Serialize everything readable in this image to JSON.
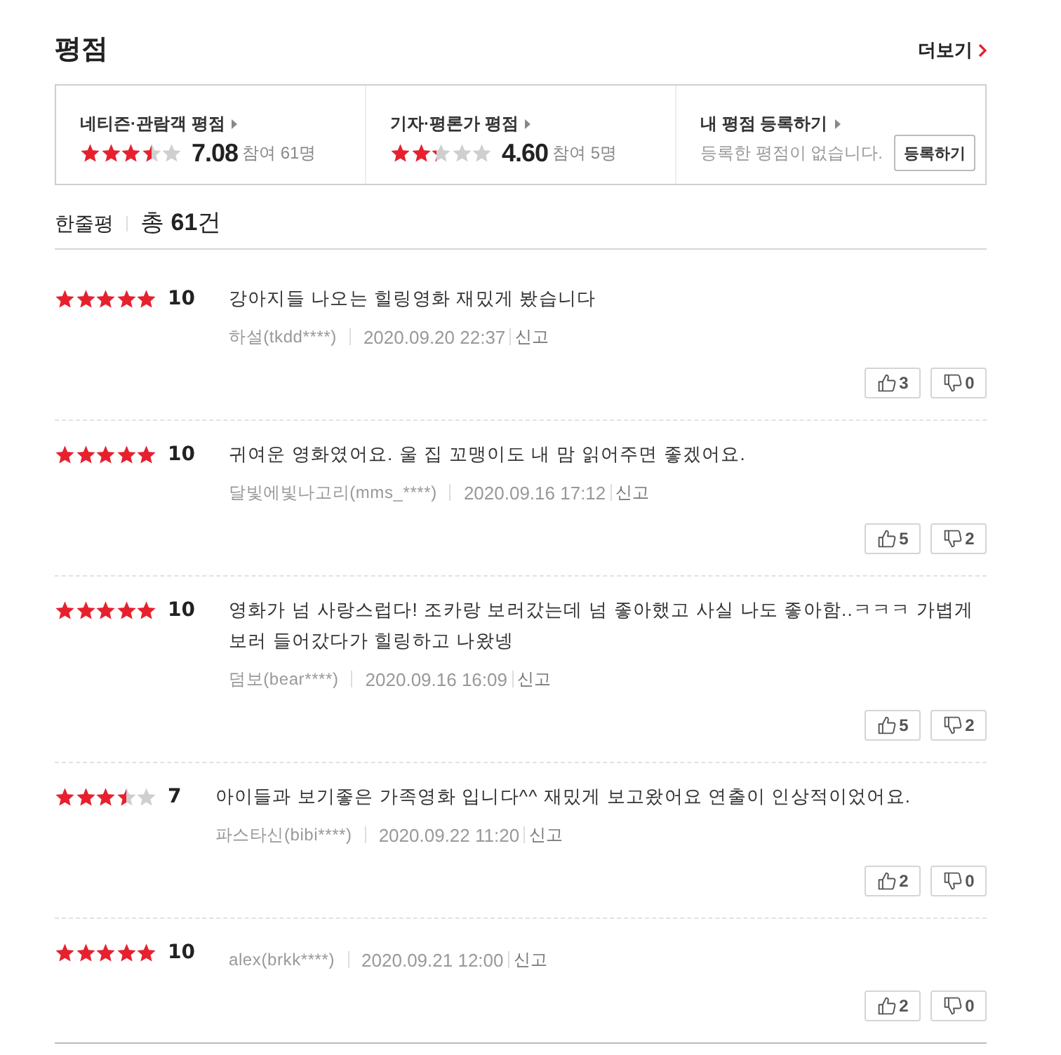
{
  "header": {
    "title": "평점",
    "more_link": "더보기"
  },
  "summary": [
    {
      "kind": "rating",
      "label": "네티즌·관람객 평점",
      "stars": 3.5,
      "score": "7.08",
      "participants": "참여 61명"
    },
    {
      "kind": "rating",
      "label": "기자·평론가 평점",
      "stars": 2.3,
      "score": "4.60",
      "participants": "참여 5명"
    },
    {
      "kind": "register",
      "label": "내 평점 등록하기",
      "message": "등록한 평점이 없습니다.",
      "button": "등록하기"
    }
  ],
  "reviews_header": {
    "title": "한줄평",
    "total": "총 **61**건"
  },
  "reviews": [
    {
      "stars": 5,
      "score": "10",
      "text": "강아지들 나오는 힐링영화 재밌게 봤습니다",
      "user": "하설(tkdd****)",
      "date": "2020.09.20 22:37",
      "report": "신고",
      "likes": "3",
      "dislikes": "0"
    },
    {
      "stars": 5,
      "score": "10",
      "text": "귀여운 영화였어요. 울 집 꼬맹이도 내 맘 읽어주면 좋겠어요.",
      "user": "달빛에빛나고리(mms_****)",
      "date": "2020.09.16 17:12",
      "report": "신고",
      "likes": "5",
      "dislikes": "2"
    },
    {
      "stars": 5,
      "score": "10",
      "text": "영화가 넘 사랑스럽다! 조카랑 보러갔는데 넘 좋아했고 사실 나도 좋아함..ㅋㅋㅋ 가볍게 보러 들어갔다가 힐링하고 나왔넹",
      "user": "덤보(bear****)",
      "date": "2020.09.16 16:09",
      "report": "신고",
      "likes": "5",
      "dislikes": "2"
    },
    {
      "stars": 3.5,
      "score": "7",
      "text": "아이들과 보기좋은 가족영화 입니다^^ 재밌게 보고왔어요 연출이 인상적이었어요.",
      "user": "파스타신(bibi****)",
      "date": "2020.09.22 11:20",
      "report": "신고",
      "likes": "2",
      "dislikes": "0"
    },
    {
      "stars": 5,
      "score": "10",
      "user": "alex(brkk****)",
      "date": "2020.09.21 12:00",
      "report": "신고",
      "likes": "2",
      "dislikes": "0"
    }
  ]
}
